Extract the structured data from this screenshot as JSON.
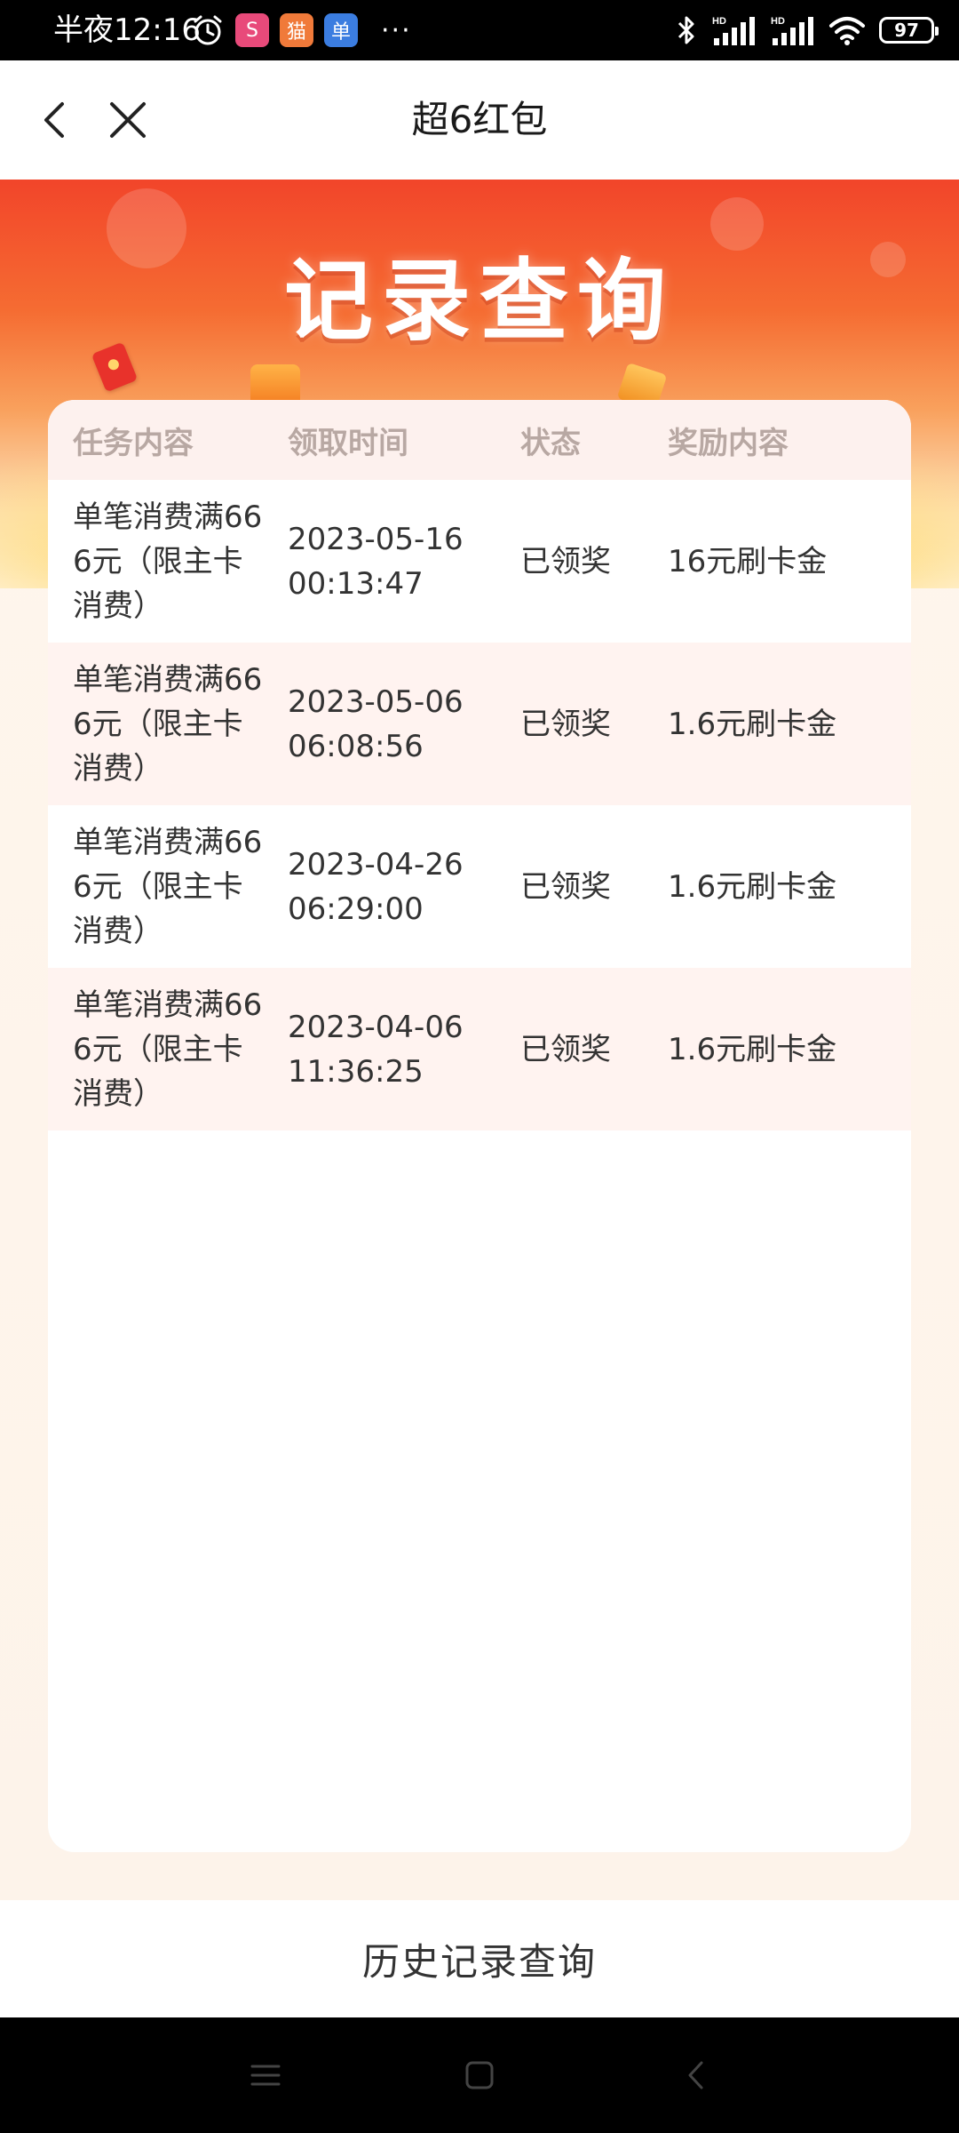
{
  "status_bar": {
    "time": "半夜12:16",
    "battery": "97",
    "apps": [
      "S",
      "猫",
      "单"
    ],
    "more": "···"
  },
  "nav": {
    "title": "超6红包"
  },
  "banner": {
    "title": "记录查询"
  },
  "table": {
    "headers": [
      "任务内容",
      "领取时间",
      "状态",
      "奖励内容"
    ],
    "rows": [
      {
        "task": "单笔消费满666元（限主卡消费）",
        "time_date": "2023-05-16",
        "time_clock": "00:13:47",
        "status": "已领奖",
        "reward": "16元刷卡金"
      },
      {
        "task": "单笔消费满666元（限主卡消费）",
        "time_date": "2023-05-06",
        "time_clock": "06:08:56",
        "status": "已领奖",
        "reward": "1.6元刷卡金"
      },
      {
        "task": "单笔消费满666元（限主卡消费）",
        "time_date": "2023-04-26",
        "time_clock": "06:29:00",
        "status": "已领奖",
        "reward": "1.6元刷卡金"
      },
      {
        "task": "单笔消费满666元（限主卡消费）",
        "time_date": "2023-04-06",
        "time_clock": "11:36:25",
        "status": "已领奖",
        "reward": "1.6元刷卡金"
      }
    ]
  },
  "footer": {
    "history_label": "历史记录查询"
  },
  "colors": {
    "banner_red": "#f2452a",
    "header_text": "#b8a8a3",
    "row_alt": "#fff3f0"
  }
}
